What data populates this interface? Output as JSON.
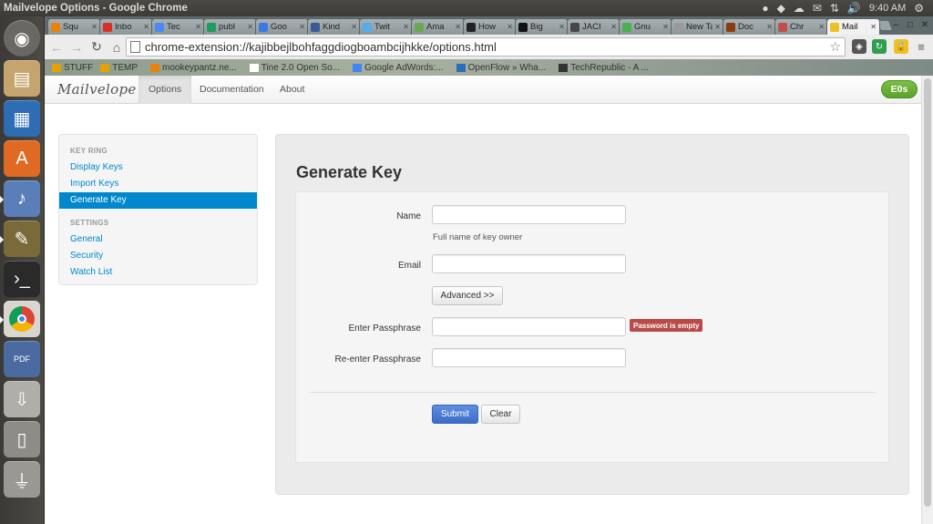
{
  "os": {
    "window_title": "Mailvelope Options - Google Chrome",
    "clock": "9:40 AM"
  },
  "browser": {
    "tabs": [
      {
        "label": "Squ",
        "color": "#e8820c"
      },
      {
        "label": "Inbo",
        "color": "#d93025"
      },
      {
        "label": "Tec",
        "color": "#4a8af4"
      },
      {
        "label": "publ",
        "color": "#1e9e5a"
      },
      {
        "label": "Goo",
        "color": "#3b78e7"
      },
      {
        "label": "Kind",
        "color": "#3b5998"
      },
      {
        "label": "Twit",
        "color": "#55acee"
      },
      {
        "label": "Ama",
        "color": "#6aa84f"
      },
      {
        "label": "How",
        "color": "#222222"
      },
      {
        "label": "Big",
        "color": "#111111"
      },
      {
        "label": "JACI",
        "color": "#464646"
      },
      {
        "label": "Gnu",
        "color": "#4caf50"
      },
      {
        "label": "New Ta",
        "color": "#999999"
      },
      {
        "label": "Doc",
        "color": "#8a3b12"
      },
      {
        "label": "Chr",
        "color": "#c0504d"
      },
      {
        "label": "Mail",
        "color": "#f0c020"
      }
    ],
    "url": "chrome-extension://kajibbejlbohfaggdiogboambcijhkke/options.html",
    "bookmarks": [
      {
        "label": "STUFF",
        "color": "#e5a000"
      },
      {
        "label": "TEMP",
        "color": "#e5a000"
      },
      {
        "label": "mookeypantz.ne...",
        "color": "#e8820c"
      },
      {
        "label": "Tine 2.0 Open So...",
        "color": "#ffffff"
      },
      {
        "label": "Google AdWords:...",
        "color": "#4285f4"
      },
      {
        "label": "OpenFlow » Wha...",
        "color": "#2a6ebb"
      },
      {
        "label": "TechRepublic - A ...",
        "color": "#333333"
      }
    ]
  },
  "app": {
    "brand": "Mailvelope",
    "nav": [
      "Options",
      "Documentation",
      "About"
    ],
    "user_badge": "E0s",
    "sidebar": {
      "key_ring_heading": "KEY RING",
      "key_ring_items": [
        "Display Keys",
        "Import Keys",
        "Generate Key"
      ],
      "settings_heading": "SETTINGS",
      "settings_items": [
        "General",
        "Security",
        "Watch List"
      ]
    },
    "form": {
      "title": "Generate Key",
      "name_label": "Name",
      "name_help": "Full name of key owner",
      "email_label": "Email",
      "advanced_button": "Advanced >>",
      "passphrase_label": "Enter Passphrase",
      "passphrase_error": "Password is empty",
      "repassphrase_label": "Re-enter Passphrase",
      "submit_button": "Submit",
      "clear_button": "Clear"
    }
  }
}
